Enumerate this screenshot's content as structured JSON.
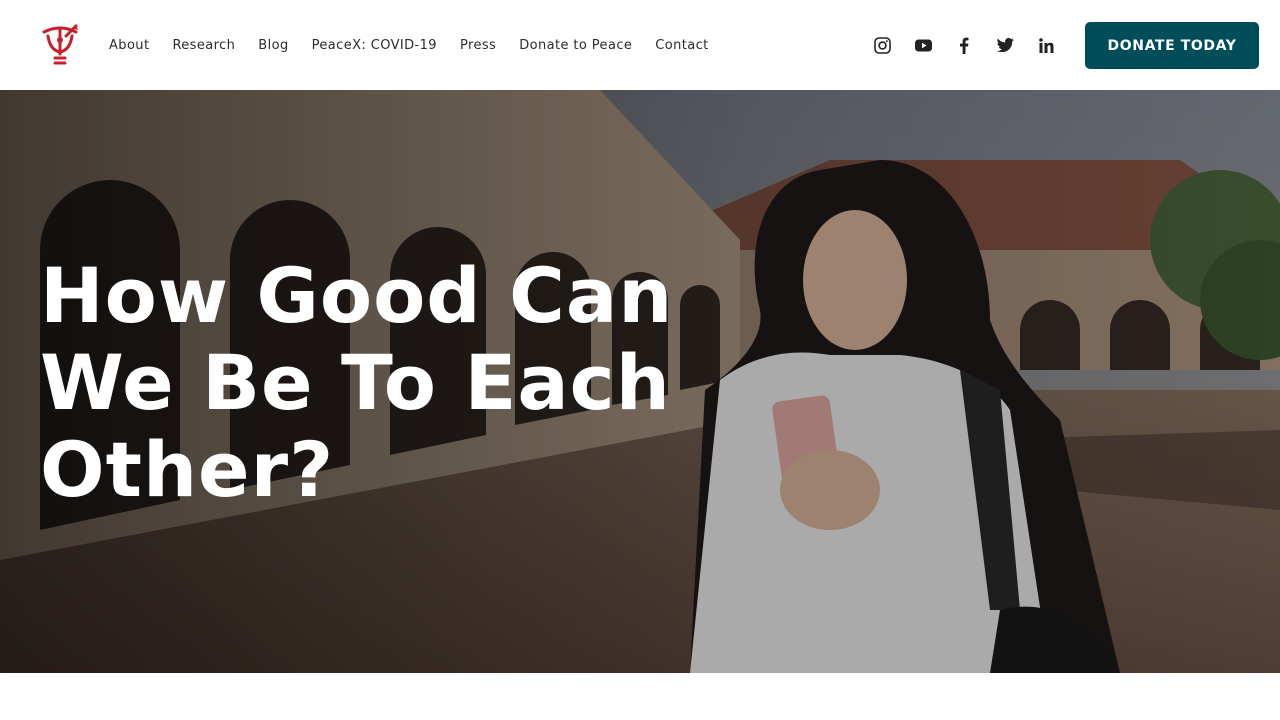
{
  "header": {
    "logo_icon": "peace-lab-logo",
    "brand_color": "#c8202a",
    "nav": [
      {
        "label": "About"
      },
      {
        "label": "Research"
      },
      {
        "label": "Blog"
      },
      {
        "label": "PeaceX: COVID-19"
      },
      {
        "label": "Press"
      },
      {
        "label": "Donate to Peace"
      },
      {
        "label": "Contact"
      }
    ],
    "social_icons": [
      "instagram-icon",
      "youtube-icon",
      "facebook-icon",
      "twitter-icon",
      "linkedin-icon"
    ],
    "donate_label": "DONATE TODAY",
    "donate_color": "#004d5a"
  },
  "hero": {
    "title": "How Good Can We Be To Each Other?"
  }
}
